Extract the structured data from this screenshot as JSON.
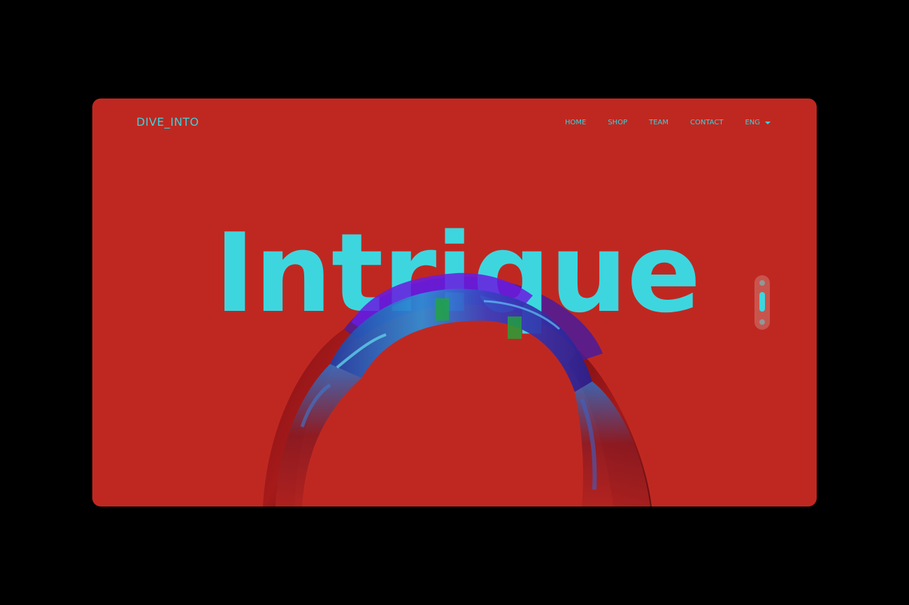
{
  "header": {
    "logo": "DIVE_INTO",
    "nav": [
      {
        "label": "HOME"
      },
      {
        "label": "SHOP"
      },
      {
        "label": "TEAM"
      },
      {
        "label": "CONTACT"
      }
    ],
    "language": "ENG"
  },
  "hero": {
    "headline": "Intrique"
  },
  "colors": {
    "background": "#000000",
    "panel": "#bf2821",
    "accent": "#39d3dd"
  },
  "icons": {
    "language_caret": "chevron-down-icon",
    "scroll": "scroll-indicator-icon"
  }
}
